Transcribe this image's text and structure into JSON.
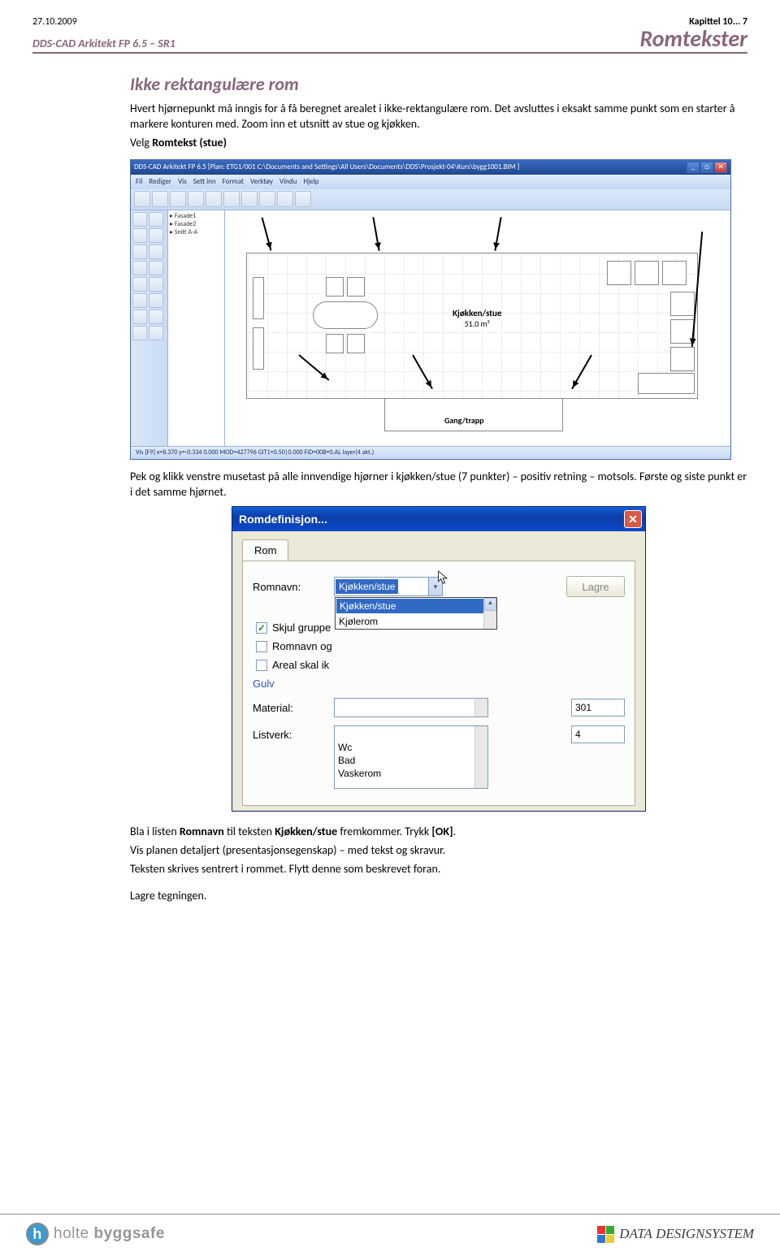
{
  "header": {
    "date": "27.10.2009",
    "chapter": "Kapittel 10... 7",
    "product": "DDS-CAD Arkitekt FP 6.5 – SR1",
    "title": "Romtekster"
  },
  "section": {
    "title": "Ikke rektangulære rom",
    "p1": "Hvert hjørnepunkt må inngis for å få beregnet arealet i ikke-rektangulære rom. Det avsluttes i eksakt samme punkt som en starter å markere konturen med. Zoom inn et utsnitt av stue og kjøkken.",
    "p2a": "Velg ",
    "p2b": "Romtekst (stue)"
  },
  "floorplan": {
    "title": "DDS-CAD Arkitekt FP 6.5   [Plan: ETG1/001 C:\\Documents and Settings\\All Users\\Documents\\DDS\\Prosjekt-04\\Kurs\\bygg1001.BIM ]",
    "menus": [
      "Fil",
      "Rediger",
      "Vis",
      "Sett inn",
      "Format",
      "Verktøy",
      "Vindu",
      "Hjelp"
    ],
    "room1_name": "Kjøkken/stue",
    "room1_area": "51.0 m²",
    "room2_name": "Gang/trapp",
    "status": "Vis [F9]  x=8.370  y=-0.334     0.000     MOD=427796     GIT1=0.50|0.000     FID=00B=0.AL     layer(4 akt.)"
  },
  "mid_text": "Pek og klikk venstre musetast på alle innvendige hjørner i kjøkken/stue (7 punkter) – positiv retning – motsols. Første og siste punkt er i det samme hjørnet.",
  "dialog": {
    "title": "Romdefinisjon...",
    "tab": "Rom",
    "romnavn_label": "Romnavn:",
    "romnavn_value": "Kjøkken/stue",
    "dropdown_items": [
      "Kjøkken/stue",
      "Kjølerom"
    ],
    "lagre_btn": "Lagre",
    "chk1": "Skjul gruppe",
    "chk2": "Romnavn og",
    "chk3": "Areal skal ik",
    "gulv_label": "Gulv",
    "material_label": "Material:",
    "material_value": "301",
    "listverk_label": "Listverk:",
    "listverk_value": "4",
    "list_items": [
      "Wc",
      "Bad",
      "Vaskerom"
    ]
  },
  "after_text": {
    "line1a": "Bla i listen ",
    "line1b": "Romnavn",
    "line1c": " til teksten ",
    "line1d": "Kjøkken/stue",
    "line1e": " fremkommer. Trykk ",
    "line1f": "[OK]",
    "line1g": ".",
    "line2": "Vis planen detaljert (presentasjonsegenskap) – med tekst og skravur.",
    "line3": "Teksten skrives sentrert i rommet. Flytt denne som beskrevet foran.",
    "line4": "Lagre tegningen."
  },
  "footer": {
    "left1": "holte",
    "left2": "byggsafe",
    "right_smallcaps": "ATA",
    "right1": "D",
    "right2": "D",
    "right3": "ESIGN",
    "right4": "S",
    "right5": "YSTEM"
  }
}
